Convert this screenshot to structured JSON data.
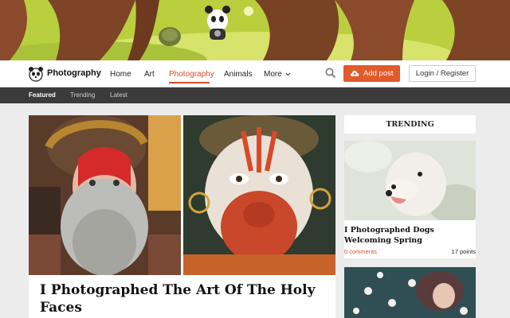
{
  "brand": {
    "name": "Photography",
    "logo_icon": "panda-logo-icon"
  },
  "nav": {
    "items": [
      {
        "label": "Home"
      },
      {
        "label": "Art"
      },
      {
        "label": "Photography",
        "active": true
      },
      {
        "label": "Animals"
      },
      {
        "label": "More"
      }
    ],
    "search_icon": "search-icon",
    "add_post_label": "Add post",
    "login_label": "Login / Register"
  },
  "subnav": {
    "items": [
      {
        "label": "Featured",
        "active": true
      },
      {
        "label": "Trending"
      },
      {
        "label": "Latest"
      }
    ]
  },
  "main_post": {
    "title": "I Photographed The Art Of The Holy Faces"
  },
  "trending": {
    "heading": "TRENDING",
    "posts": [
      {
        "title": "I Photographed Dogs Welcoming Spring",
        "comments": "0 comments",
        "points": "17 points"
      }
    ]
  },
  "colors": {
    "accent": "#e15a2a",
    "active_nav": "#d94b2b",
    "subnav_bg": "#3b3b3b"
  }
}
